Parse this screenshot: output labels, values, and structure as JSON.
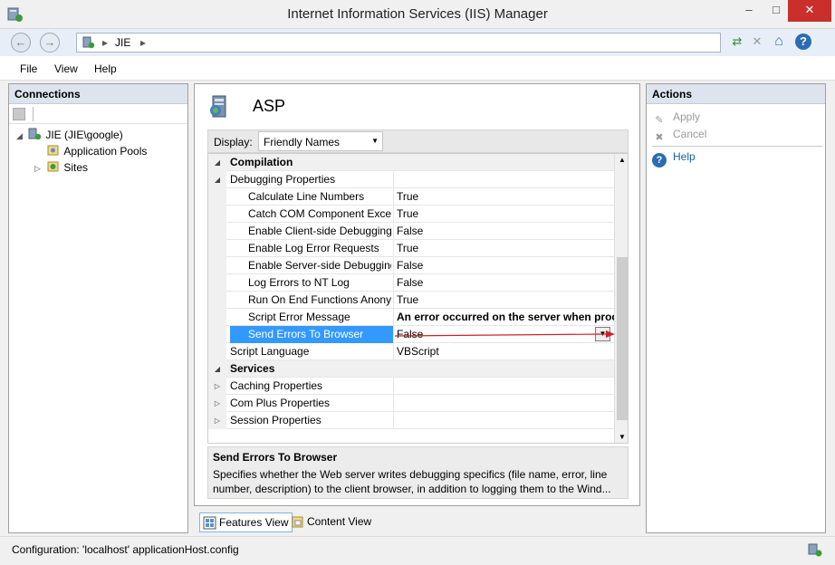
{
  "window": {
    "title": "Internet Information Services (IIS) Manager",
    "minimize_glyph": "–",
    "maximize_glyph": "□",
    "close_glyph": "✕"
  },
  "address": {
    "back_glyph": "←",
    "forward_glyph": "→",
    "separator": "▸",
    "crumbs": [
      "JIE"
    ]
  },
  "toolbar_icons": [
    "refresh-icon",
    "stop-icon",
    "home-icon",
    "help-icon"
  ],
  "toolbar_glyphs": {
    "refresh": "⇄",
    "stop": "✕",
    "home": "⌂",
    "help": "?"
  },
  "menu": {
    "items": [
      "File",
      "View",
      "Help"
    ]
  },
  "connections": {
    "header": "Connections",
    "tree": [
      {
        "label": "JIE (JIE\\google)",
        "twisty": "◢"
      },
      {
        "label": "Application Pools",
        "twisty": ""
      },
      {
        "label": "Sites",
        "twisty": "▷"
      }
    ]
  },
  "feature": {
    "title": "ASP",
    "display_label": "Display:",
    "display_value": "Friendly Names",
    "dropdown_glyph": "▼"
  },
  "grid": {
    "expanded_glyph": "◢",
    "collapsed_glyph": "▷",
    "rows": [
      {
        "kind": "cat",
        "name": "Compilation",
        "value": "",
        "toggle": "◢"
      },
      {
        "kind": "grp",
        "name": "Debugging Properties",
        "value": "",
        "toggle": "◢"
      },
      {
        "kind": "item",
        "name": "Calculate Line Numbers",
        "value": "True"
      },
      {
        "kind": "item",
        "name": "Catch COM Component Exce",
        "value": "True"
      },
      {
        "kind": "item",
        "name": "Enable Client-side Debugging",
        "value": "False"
      },
      {
        "kind": "item",
        "name": "Enable Log Error Requests",
        "value": "True"
      },
      {
        "kind": "item",
        "name": "Enable Server-side Debugging",
        "value": "False"
      },
      {
        "kind": "item",
        "name": "Log Errors to NT Log",
        "value": "False"
      },
      {
        "kind": "item",
        "name": "Run On End Functions Anony",
        "value": "True"
      },
      {
        "kind": "item",
        "name": "Script Error Message",
        "value": "An error occurred on the server when proc",
        "bold": true
      },
      {
        "kind": "sel",
        "name": "Send Errors To Browser",
        "value": "False"
      },
      {
        "kind": "grp",
        "name": "Script Language",
        "value": "VBScript"
      },
      {
        "kind": "cat",
        "name": "Services",
        "value": "",
        "toggle": "◢"
      },
      {
        "kind": "grp",
        "name": "Caching Properties",
        "value": "",
        "toggle": "▷"
      },
      {
        "kind": "grp",
        "name": "Com Plus Properties",
        "value": "",
        "toggle": "▷"
      },
      {
        "kind": "grp",
        "name": "Session Properties",
        "value": "",
        "toggle": "▷"
      }
    ],
    "scroll_up": "▲",
    "scroll_down": "▼",
    "dropdown_glyph": "▼"
  },
  "description": {
    "title": "Send Errors To Browser",
    "body": "Specifies whether the Web server writes debugging specifics (file name, error, line number, description) to the client browser, in addition to logging them to the Wind..."
  },
  "view_tabs": [
    "Features View",
    "Content View"
  ],
  "actions": {
    "header": "Actions",
    "apply": "Apply",
    "cancel": "Cancel",
    "help": "Help",
    "apply_glyph": "✎",
    "cancel_glyph": "✖",
    "help_glyph": "?"
  },
  "status": {
    "text": "Configuration: 'localhost' applicationHost.config"
  },
  "colors": {
    "selection": "#3399ff",
    "close_button": "#c9302c",
    "panel_header": "#dde4ee",
    "link": "#1a5ea8",
    "annotation_arrow": "#d0202a"
  }
}
